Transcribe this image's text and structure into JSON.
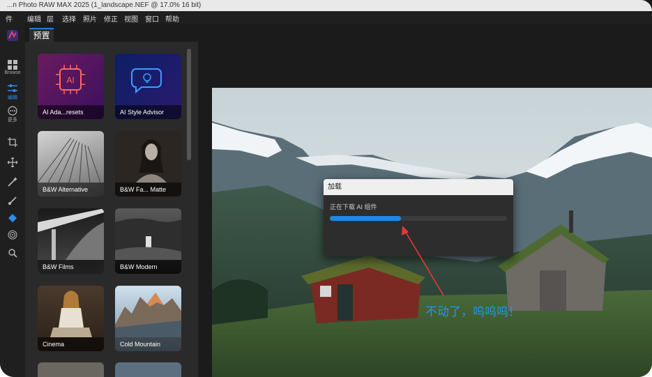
{
  "window": {
    "title": "...n Photo RAW MAX 2025 (1_landscape.NEF @ 17.0% 16 bit)"
  },
  "menu": [
    "件",
    "编辑",
    "层",
    "选择",
    "照片",
    "修正",
    "视图",
    "窗口",
    "帮助"
  ],
  "rail": {
    "browse_label": "Browse",
    "edit_label": "编辑",
    "more_label": "更多"
  },
  "panel": {
    "tab_label": "预置",
    "presets": [
      {
        "name": "AI Ada...resets",
        "thumb": "ai-chip-icon"
      },
      {
        "name": "AI Style Advisor",
        "thumb": "chat-bulb-icon"
      },
      {
        "name": "B&W Alternative",
        "thumb": "bw-architecture"
      },
      {
        "name": "B&W Fa... Matte",
        "thumb": "bw-portrait"
      },
      {
        "name": "B&W Films",
        "thumb": "bw-bridge"
      },
      {
        "name": "B&W Modern",
        "thumb": "bw-waterfall"
      },
      {
        "name": "Cinema",
        "thumb": "woman-sitting"
      },
      {
        "name": "Cold Mountain",
        "thumb": "mountain-peaks"
      }
    ]
  },
  "dialog": {
    "title": "加载",
    "message": "正在下载 AI 组件",
    "progress": 0.4
  },
  "annotation": {
    "text": "不动了，呜呜呜！",
    "color": "#2196f3"
  },
  "colors": {
    "accent": "#1e88e5",
    "arrow": "#e53935"
  }
}
